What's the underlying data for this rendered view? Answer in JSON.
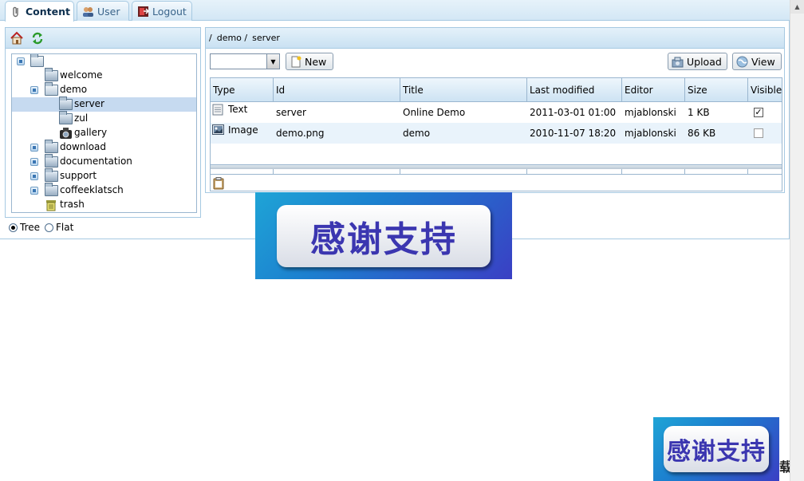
{
  "tabs": [
    {
      "label": "Content",
      "icon": "paperclip-icon",
      "active": true
    },
    {
      "label": "User",
      "icon": "users-icon",
      "active": false
    },
    {
      "label": "Logout",
      "icon": "logout-icon",
      "active": false
    }
  ],
  "tree": {
    "items": [
      {
        "label": "",
        "icon": "folder-root-icon",
        "expander": "expanded"
      },
      {
        "label": "welcome",
        "icon": "page-folder-icon"
      },
      {
        "label": "demo",
        "icon": "folder-open-icon",
        "expander": "expanded"
      },
      {
        "label": "server",
        "icon": "page-folder-icon",
        "selected": true
      },
      {
        "label": "zul",
        "icon": "page-folder-icon"
      },
      {
        "label": "gallery",
        "icon": "camera-icon"
      },
      {
        "label": "download",
        "icon": "folder-icon",
        "expander": "collapsed"
      },
      {
        "label": "documentation",
        "icon": "folder-icon",
        "expander": "collapsed"
      },
      {
        "label": "support",
        "icon": "folder-icon",
        "expander": "collapsed"
      },
      {
        "label": "coffeeklatsch",
        "icon": "folder-icon",
        "expander": "collapsed"
      },
      {
        "label": "trash",
        "icon": "trash-icon"
      }
    ]
  },
  "view_options": {
    "tree": "Tree",
    "flat": "Flat",
    "selected": "Tree"
  },
  "breadcrumb": [
    "/",
    "demo /",
    "server"
  ],
  "toolbar": {
    "type_select_value": "",
    "new_label": "New",
    "upload_label": "Upload",
    "view_label": "View"
  },
  "table": {
    "columns": [
      "Type",
      "Id",
      "Title",
      "Last modified",
      "Editor",
      "Size",
      "Visible"
    ],
    "rows": [
      {
        "type": "Text",
        "type_icon": "text-doc-icon",
        "id": "server",
        "title": "Online Demo",
        "modified": "2011-03-01 01:00",
        "editor": "mjablonski",
        "size": "1 KB",
        "visible": true
      },
      {
        "type": "Image",
        "type_icon": "image-icon",
        "id": "demo.png",
        "title": "demo",
        "modified": "2010-11-07 18:20",
        "editor": "mjablonski",
        "size": "86 KB",
        "visible": false
      }
    ]
  },
  "overlays": {
    "banner_text": "感谢支持",
    "corner_text": "载"
  },
  "colors": {
    "panel_border": "#a6c9e2",
    "header_gradient_top": "#e4f1fa",
    "selected_row": "#c6daf0",
    "banner_text": "#3b36b0"
  }
}
